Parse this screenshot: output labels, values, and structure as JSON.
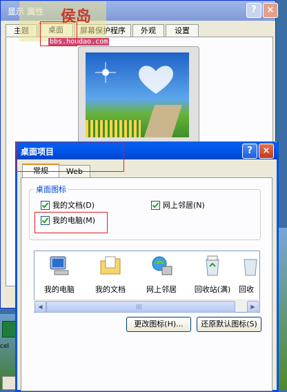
{
  "back_window": {
    "title": "显示 属性",
    "help_label": "?",
    "close_label": "×",
    "tabs": [
      {
        "label": "主题"
      },
      {
        "label": "桌面"
      },
      {
        "label": "屏幕保护程序"
      },
      {
        "label": "外观"
      },
      {
        "label": "设置"
      }
    ],
    "selected_tab": "桌面"
  },
  "watermark": {
    "logo_text": "侯岛",
    "url": "bbs.houdao.com"
  },
  "dialog": {
    "title": "桌面项目",
    "help_label": "?",
    "close_label": "×",
    "tabs": [
      {
        "label": "常规"
      },
      {
        "label": "Web"
      }
    ],
    "group_label": "桌面图标",
    "checkboxes": [
      {
        "label": "我的文档(D)",
        "checked": true
      },
      {
        "label": "网上邻居(N)",
        "checked": true
      },
      {
        "label": "我的电脑(M)",
        "checked": true
      }
    ],
    "icons": [
      {
        "label": "我的电脑",
        "icon": "computer-icon"
      },
      {
        "label": "我的文档",
        "icon": "documents-folder-icon"
      },
      {
        "label": "网上邻居",
        "icon": "network-icon"
      },
      {
        "label": "回收站(满)",
        "icon": "recycle-bin-full-icon"
      },
      {
        "label": "回收",
        "icon": "recycle-bin-icon"
      }
    ],
    "change_icon_button": "更改图标(H)...",
    "restore_default_button": "还原默认图标(S)"
  },
  "desktop": {
    "icon_label": "cel"
  },
  "colors": {
    "title_bar_active": "#0058ee",
    "highlight_box": "#e02020",
    "tab_selected_accent": "#e68b2c"
  }
}
